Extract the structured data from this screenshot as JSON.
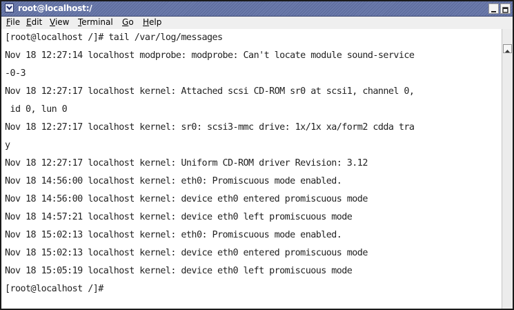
{
  "window": {
    "title": "root@localhost:/",
    "buttons": [
      "minimize-icon",
      "maximize-icon",
      "close-icon"
    ]
  },
  "menubar": {
    "items": [
      {
        "pre": "",
        "u": "F",
        "post": "ile"
      },
      {
        "pre": "",
        "u": "E",
        "post": "dit"
      },
      {
        "pre": "",
        "u": "V",
        "post": "iew"
      },
      {
        "pre": "",
        "u": "T",
        "post": "erminal"
      },
      {
        "pre": "",
        "u": "G",
        "post": "o"
      },
      {
        "pre": "",
        "u": "H",
        "post": "elp"
      }
    ]
  },
  "terminal": {
    "lines": [
      "[root@localhost /]# tail /var/log/messages",
      "Nov 18 12:27:14 localhost modprobe: modprobe: Can't locate module sound-service",
      "-0-3",
      "Nov 18 12:27:17 localhost kernel: Attached scsi CD-ROM sr0 at scsi1, channel 0,",
      " id 0, lun 0",
      "Nov 18 12:27:17 localhost kernel: sr0: scsi3-mmc drive: 1x/1x xa/form2 cdda tra",
      "y",
      "Nov 18 12:27:17 localhost kernel: Uniform CD-ROM driver Revision: 3.12",
      "Nov 18 14:56:00 localhost kernel: eth0: Promiscuous mode enabled.",
      "Nov 18 14:56:00 localhost kernel: device eth0 entered promiscuous mode",
      "Nov 18 14:57:21 localhost kernel: device eth0 left promiscuous mode",
      "Nov 18 15:02:13 localhost kernel: eth0: Promiscuous mode enabled.",
      "Nov 18 15:02:13 localhost kernel: device eth0 entered promiscuous mode",
      "Nov 18 15:05:19 localhost kernel: device eth0 left promiscuous mode",
      "[root@localhost /]#"
    ]
  },
  "colors": {
    "titlebar": "#5b6a9a",
    "terminal_bg": "#ffffff",
    "terminal_text": "#222222"
  }
}
